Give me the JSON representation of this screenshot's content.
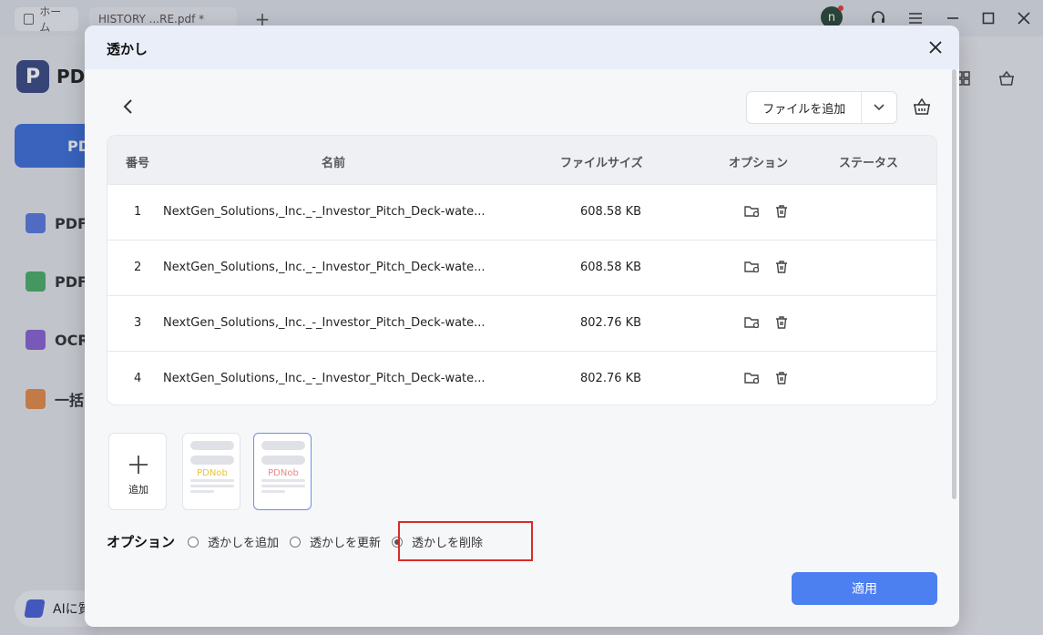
{
  "titlebar": {
    "home_tab": "ホーム",
    "file_tab": "HISTORY ...RE.pdf *",
    "new_tab": "+",
    "avatar_letter": "n"
  },
  "sidebar": {
    "app_name": "PDF",
    "primary_button": "PDF",
    "items": [
      {
        "label": "PDF",
        "icon": "edit-pdf-icon"
      },
      {
        "label": "PDF",
        "icon": "convert-pdf-icon"
      },
      {
        "label": "OCR",
        "icon": "ocr-icon"
      },
      {
        "label": "一括",
        "icon": "batch-icon"
      }
    ],
    "ai_label": "AIに質"
  },
  "dialog": {
    "title": "透かし",
    "add_file": "ファイルを追加",
    "table": {
      "headers": [
        "番号",
        "名前",
        "ファイルサイズ",
        "オプション",
        "ステータス"
      ],
      "rows": [
        {
          "no": "1",
          "name": "NextGen_Solutions,_Inc._-_Investor_Pitch_Deck-wate...",
          "size": "608.58 KB",
          "status": ""
        },
        {
          "no": "2",
          "name": "NextGen_Solutions,_Inc._-_Investor_Pitch_Deck-wate...",
          "size": "608.58 KB",
          "status": ""
        },
        {
          "no": "3",
          "name": "NextGen_Solutions,_Inc._-_Investor_Pitch_Deck-wate...",
          "size": "802.76 KB",
          "status": ""
        },
        {
          "no": "4",
          "name": "NextGen_Solutions,_Inc._-_Investor_Pitch_Deck-wate...",
          "size": "802.76 KB",
          "status": ""
        }
      ]
    },
    "templates": {
      "add_label": "追加",
      "items": [
        {
          "watermark": "PDNob",
          "color": "#e8c33a",
          "selected": false
        },
        {
          "watermark": "PDNob",
          "color": "#e58a8a",
          "selected": true
        }
      ]
    },
    "options": {
      "label": "オプション",
      "choices": [
        "透かしを追加",
        "透かしを更新",
        "透かしを削除"
      ],
      "selected": "透かしを削除"
    },
    "apply": "適用"
  },
  "colors": {
    "accent": "#4c7ff0",
    "highlight_box": "#d82c2c"
  }
}
